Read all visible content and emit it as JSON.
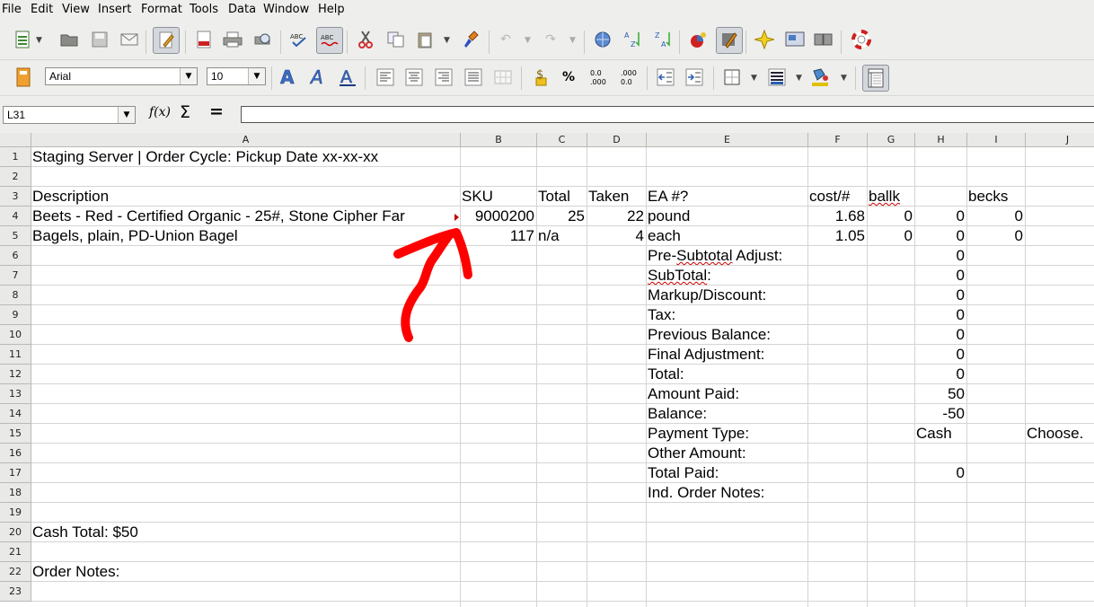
{
  "menu": [
    "File",
    "Edit",
    "View",
    "Insert",
    "Format",
    "Tools",
    "Data",
    "Window",
    "Help"
  ],
  "formatting": {
    "font_name": "Arial",
    "font_size": "10"
  },
  "name_box": "L31",
  "formula": "",
  "columns": [
    "A",
    "B",
    "C",
    "D",
    "E",
    "F",
    "G",
    "H",
    "I",
    "J"
  ],
  "rows": [
    "1",
    "2",
    "3",
    "4",
    "5",
    "6",
    "7",
    "8",
    "9",
    "10",
    "11",
    "12",
    "13",
    "14",
    "15",
    "16",
    "17",
    "18",
    "19",
    "20",
    "21",
    "22",
    "23"
  ],
  "cells": {
    "A1": "Staging Server | Order Cycle: Pickup Date xx-xx-xx",
    "A3": "Description",
    "B3": "SKU",
    "C3": "Total",
    "D3": "Taken",
    "E3": "EA #?",
    "F3": "cost/#",
    "G3": "ballk",
    "I3": "becks",
    "A4": "Beets - Red - Certified Organic - 25#, Stone Cipher Far",
    "B4": "9000200",
    "C4": "25",
    "D4": "22",
    "E4": "pound",
    "F4": "1.68",
    "G4": "0",
    "H4": "0",
    "I4": "0",
    "A5": "Bagels, plain, PD-Union Bagel",
    "B5": "117",
    "C5": "n/a",
    "D5": "4",
    "E5": "each",
    "F5": "1.05",
    "G5": "0",
    "H5": "0",
    "I5": "0",
    "E6": "Pre-Subtotal Adjust:",
    "H6": "0",
    "E7": "SubTotal:",
    "H7": "0",
    "E8": "Markup/Discount:",
    "H8": "0",
    "E9": "Tax:",
    "H9": "0",
    "E10": "Previous Balance:",
    "H10": "0",
    "E11": "Final Adjustment:",
    "H11": "0",
    "E12": "Total:",
    "H12": "0",
    "E13": "Amount Paid:",
    "H13": "50",
    "E14": "Balance:",
    "H14": "-50",
    "E15": "Payment Type:",
    "H15": "Cash",
    "J15": "Choose.",
    "E16": "Other Amount:",
    "E17": "Total Paid:",
    "H17": "0",
    "E18": "Ind. Order Notes:",
    "A20": "Cash Total: $50",
    "A22": "Order Notes:"
  },
  "annotation": {
    "color": "#ff0000",
    "shape": "hand-drawn-arrow",
    "points_to": "A4"
  }
}
